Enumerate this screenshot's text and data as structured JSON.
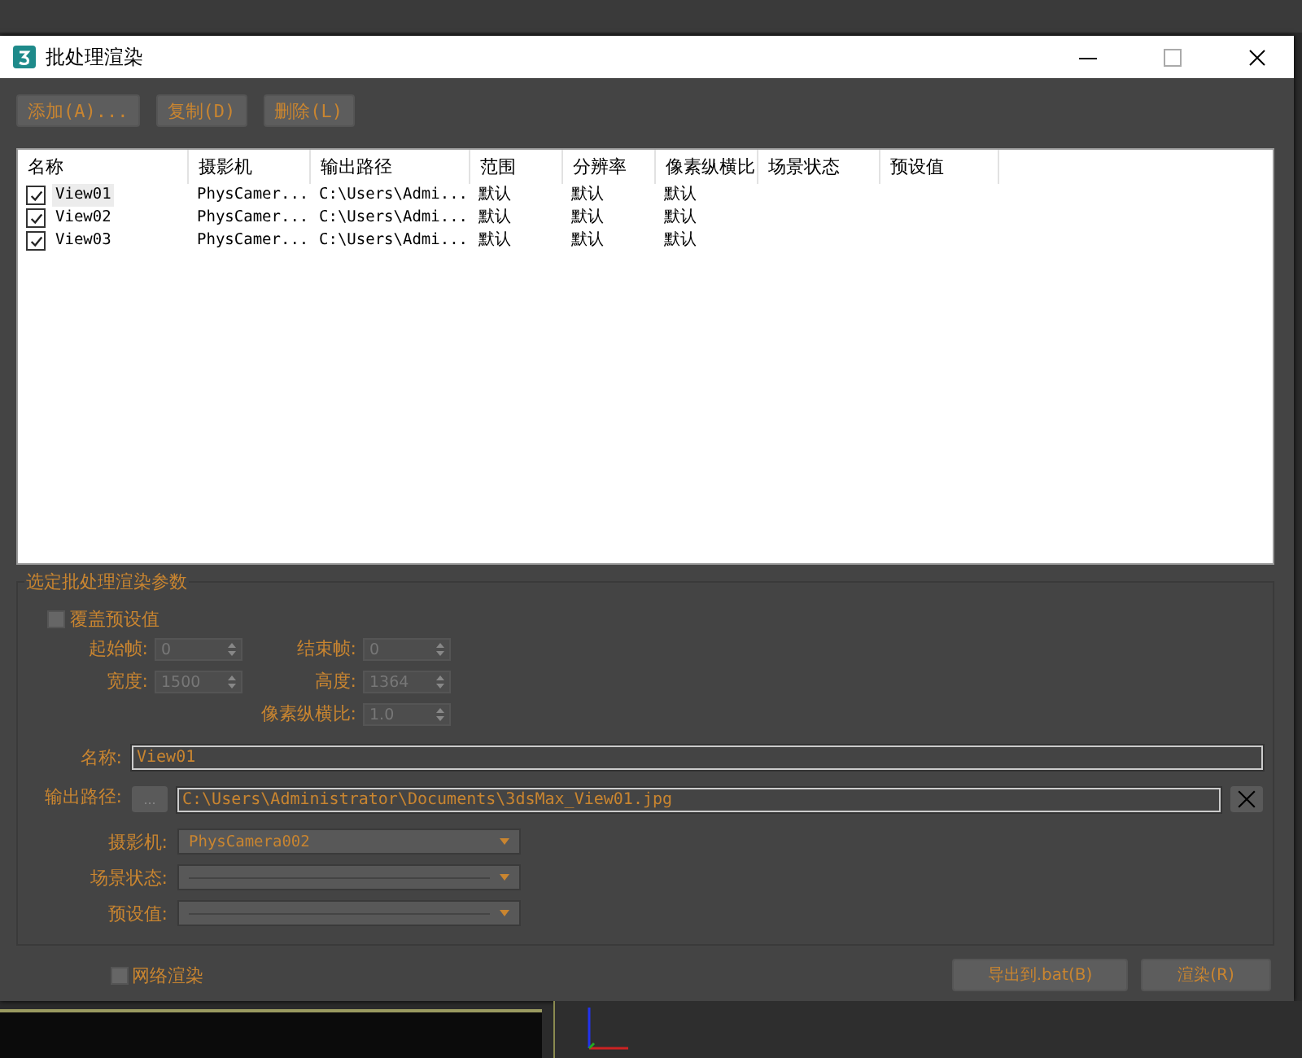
{
  "window": {
    "title": "批处理渲染"
  },
  "toolbar": [
    {
      "label": "添加(A)..."
    },
    {
      "label": "复制(D)"
    },
    {
      "label": "删除(L)"
    }
  ],
  "list": {
    "columns": [
      "名称",
      "摄影机",
      "输出路径",
      "范围",
      "分辨率",
      "像素纵横比",
      "场景状态",
      "预设值"
    ],
    "rows": [
      {
        "checked": true,
        "selected": true,
        "cells": [
          "View01",
          "PhysCamer...",
          "C:\\Users\\Admi...",
          "默认",
          "默认",
          "默认"
        ]
      },
      {
        "checked": true,
        "selected": false,
        "cells": [
          "View02",
          "PhysCamer...",
          "C:\\Users\\Admi...",
          "默认",
          "默认",
          "默认"
        ]
      },
      {
        "checked": true,
        "selected": false,
        "cells": [
          "View03",
          "PhysCamer...",
          "C:\\Users\\Admi...",
          "默认",
          "默认",
          "默认"
        ]
      }
    ]
  },
  "params": {
    "title": "选定批处理渲染参数",
    "override": {
      "label": "覆盖预设值",
      "checked": false
    },
    "spinners": [
      {
        "label": "起始帧:",
        "value": "0"
      },
      {
        "label": "结束帧:",
        "value": "0"
      },
      {
        "label": "宽度:",
        "value": "1500"
      },
      {
        "label": "高度:",
        "value": "1364"
      },
      {
        "label": "像素纵横比:",
        "value": "1.0"
      }
    ],
    "name": {
      "label": "名称:",
      "value": "View01"
    },
    "output": {
      "label": "输出路径:",
      "browse": "...",
      "value": "C:\\Users\\Administrator\\Documents\\3dsMax_View01.jpg"
    },
    "dropdowns": [
      {
        "label": "摄影机:",
        "value": "PhysCamera002"
      },
      {
        "label": "场景状态:"
      },
      {
        "label": "预设值:"
      }
    ]
  },
  "net_render": {
    "label": "网络渲染",
    "checked": false
  },
  "buttons": [
    "导出到.bat(B)",
    "渲染(R)"
  ]
}
